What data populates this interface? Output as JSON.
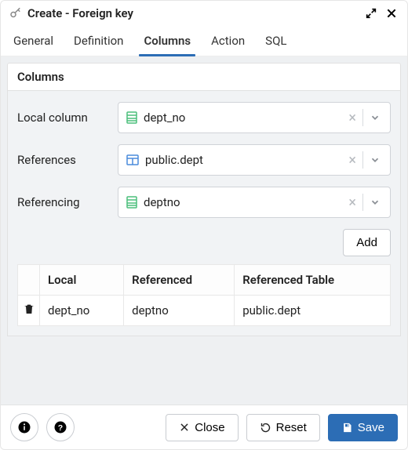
{
  "title": "Create - Foreign key",
  "tabs": [
    "General",
    "Definition",
    "Columns",
    "Action",
    "SQL"
  ],
  "active_tab_index": 2,
  "panel_title": "Columns",
  "fields": {
    "local_column": {
      "label": "Local column",
      "value": "dept_no",
      "icon": "column"
    },
    "references": {
      "label": "References",
      "value": "public.dept",
      "icon": "table"
    },
    "referencing": {
      "label": "Referencing",
      "value": "deptno",
      "icon": "column"
    }
  },
  "add_button": "Add",
  "table": {
    "headers": [
      "Local",
      "Referenced",
      "Referenced Table"
    ],
    "rows": [
      {
        "local": "dept_no",
        "referenced": "deptno",
        "ref_table": "public.dept"
      }
    ]
  },
  "footer": {
    "close": "Close",
    "reset": "Reset",
    "save": "Save"
  }
}
